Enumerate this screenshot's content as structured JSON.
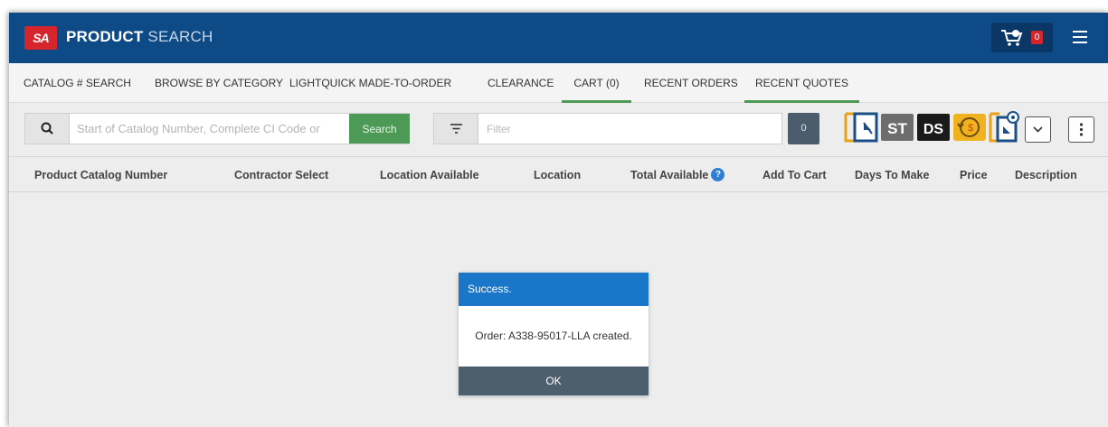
{
  "header": {
    "logo_text": "SA",
    "title_bold": "PRODUCT",
    "title_light": "SEARCH",
    "cart_badge": "0"
  },
  "nav": {
    "tabs": [
      {
        "label": "CATALOG # SEARCH",
        "active": false
      },
      {
        "label": "BROWSE BY CATEGORY",
        "active": false
      },
      {
        "label": "LIGHTQUICK MADE-TO-ORDER",
        "active": false
      },
      {
        "label": "CLEARANCE",
        "active": false
      },
      {
        "label": "CART (0)",
        "active": true
      },
      {
        "label": "RECENT ORDERS",
        "active": false
      },
      {
        "label": "RECENT QUOTES",
        "active": true
      }
    ]
  },
  "toolbar": {
    "search_placeholder": "Start of Catalog Number, Complete CI Code or",
    "search_button": "Search",
    "filter_placeholder": "Filter",
    "count": "0",
    "icons": [
      "select-frame-icon",
      "st-icon",
      "ds-icon",
      "price-refresh-icon",
      "config-frame-icon"
    ],
    "st_label": "ST",
    "ds_label": "DS"
  },
  "table": {
    "columns": [
      "Product Catalog Number",
      "Contractor Select",
      "Location Available",
      "Location",
      "Total Available",
      "Add To Cart",
      "Days To Make",
      "Price",
      "Description"
    ],
    "help_glyph": "?"
  },
  "modal": {
    "title": "Success.",
    "message": "Order: A338-95017-LLA created.",
    "ok_label": "OK"
  },
  "colors": {
    "header_bg": "#0d4a86",
    "accent_green": "#4c9a55",
    "modal_blue": "#1976c8",
    "logo_red": "#d6252c"
  }
}
